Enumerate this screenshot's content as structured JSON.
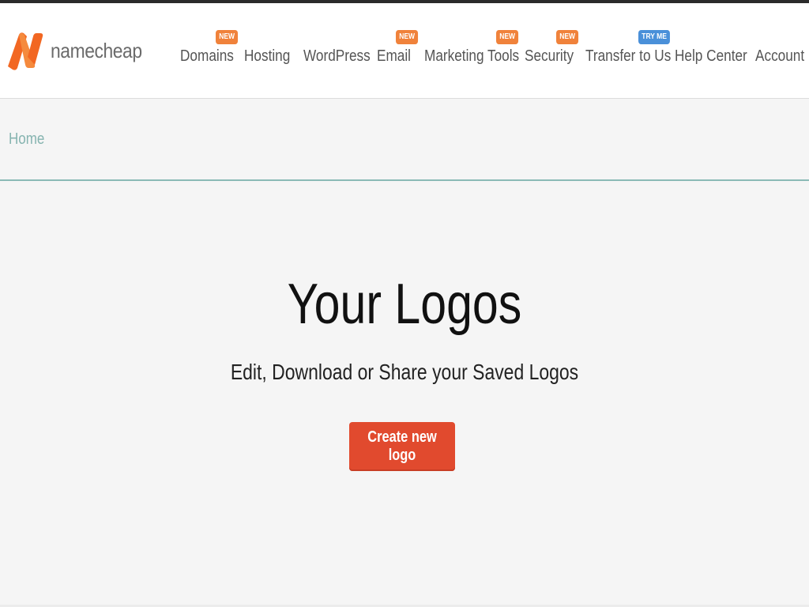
{
  "brand": {
    "name": "namecheap",
    "logo_icon": "namecheap-n-logo",
    "accent_color": "#f26722"
  },
  "nav": {
    "items": [
      {
        "label": "Domains",
        "badge": "NEW"
      },
      {
        "label": "Hosting",
        "badge": null
      },
      {
        "label": "WordPress",
        "badge": null
      },
      {
        "label": "Email",
        "badge": "NEW"
      },
      {
        "label": "Marketing Tools",
        "badge": "NEW"
      },
      {
        "label": "Security",
        "badge": "NEW"
      },
      {
        "label": "Transfer to Us",
        "badge": "TRY ME"
      },
      {
        "label": "Help Center",
        "badge": null
      },
      {
        "label": "Account",
        "badge": null
      }
    ],
    "badge_colors": {
      "new": "#f0823b",
      "try_me": "#4a90d9"
    }
  },
  "breadcrumb": {
    "items": [
      "Home"
    ]
  },
  "hero": {
    "title": "Your Logos",
    "subtitle": "Edit, Download or Share your Saved Logos",
    "cta_label": "Create new logo",
    "cta_color": "#e14a2e"
  }
}
